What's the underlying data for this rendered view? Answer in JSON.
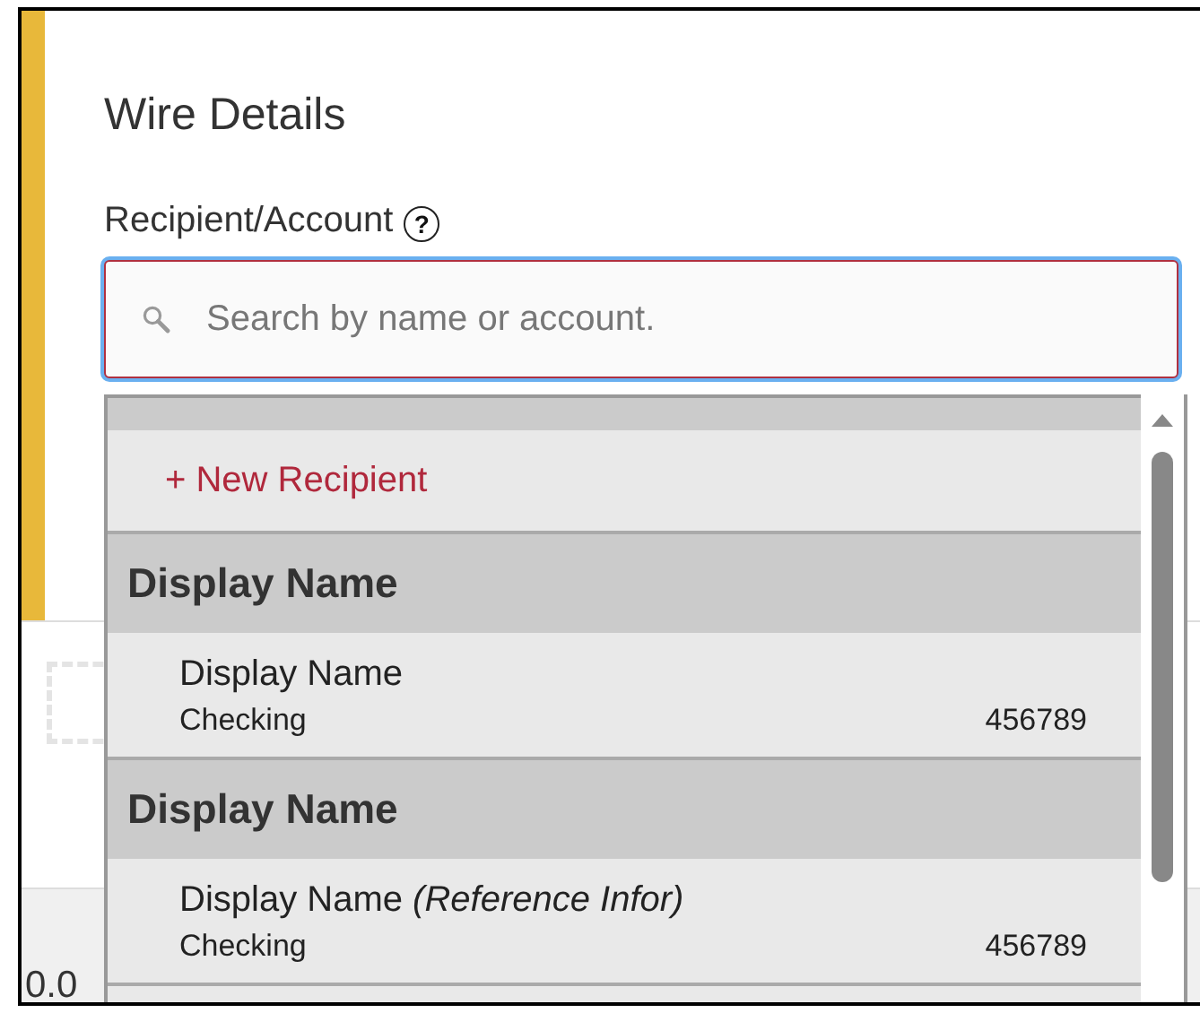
{
  "section": {
    "title": "Wire Details",
    "field_label": "Recipient/Account",
    "help": "?"
  },
  "search": {
    "placeholder": "Search by name or account."
  },
  "dropdown": {
    "new_recipient": "+ New Recipient",
    "groups": [
      {
        "header": "Display Name",
        "items": [
          {
            "name": "Display Name",
            "type": "Checking",
            "account": "456789"
          }
        ]
      },
      {
        "header": "Display Name",
        "items": [
          {
            "name": "Display Name *(Reference Infor)*",
            "type": "Checking",
            "account": "456789"
          }
        ]
      }
    ]
  },
  "background": {
    "amount": "0.0"
  }
}
